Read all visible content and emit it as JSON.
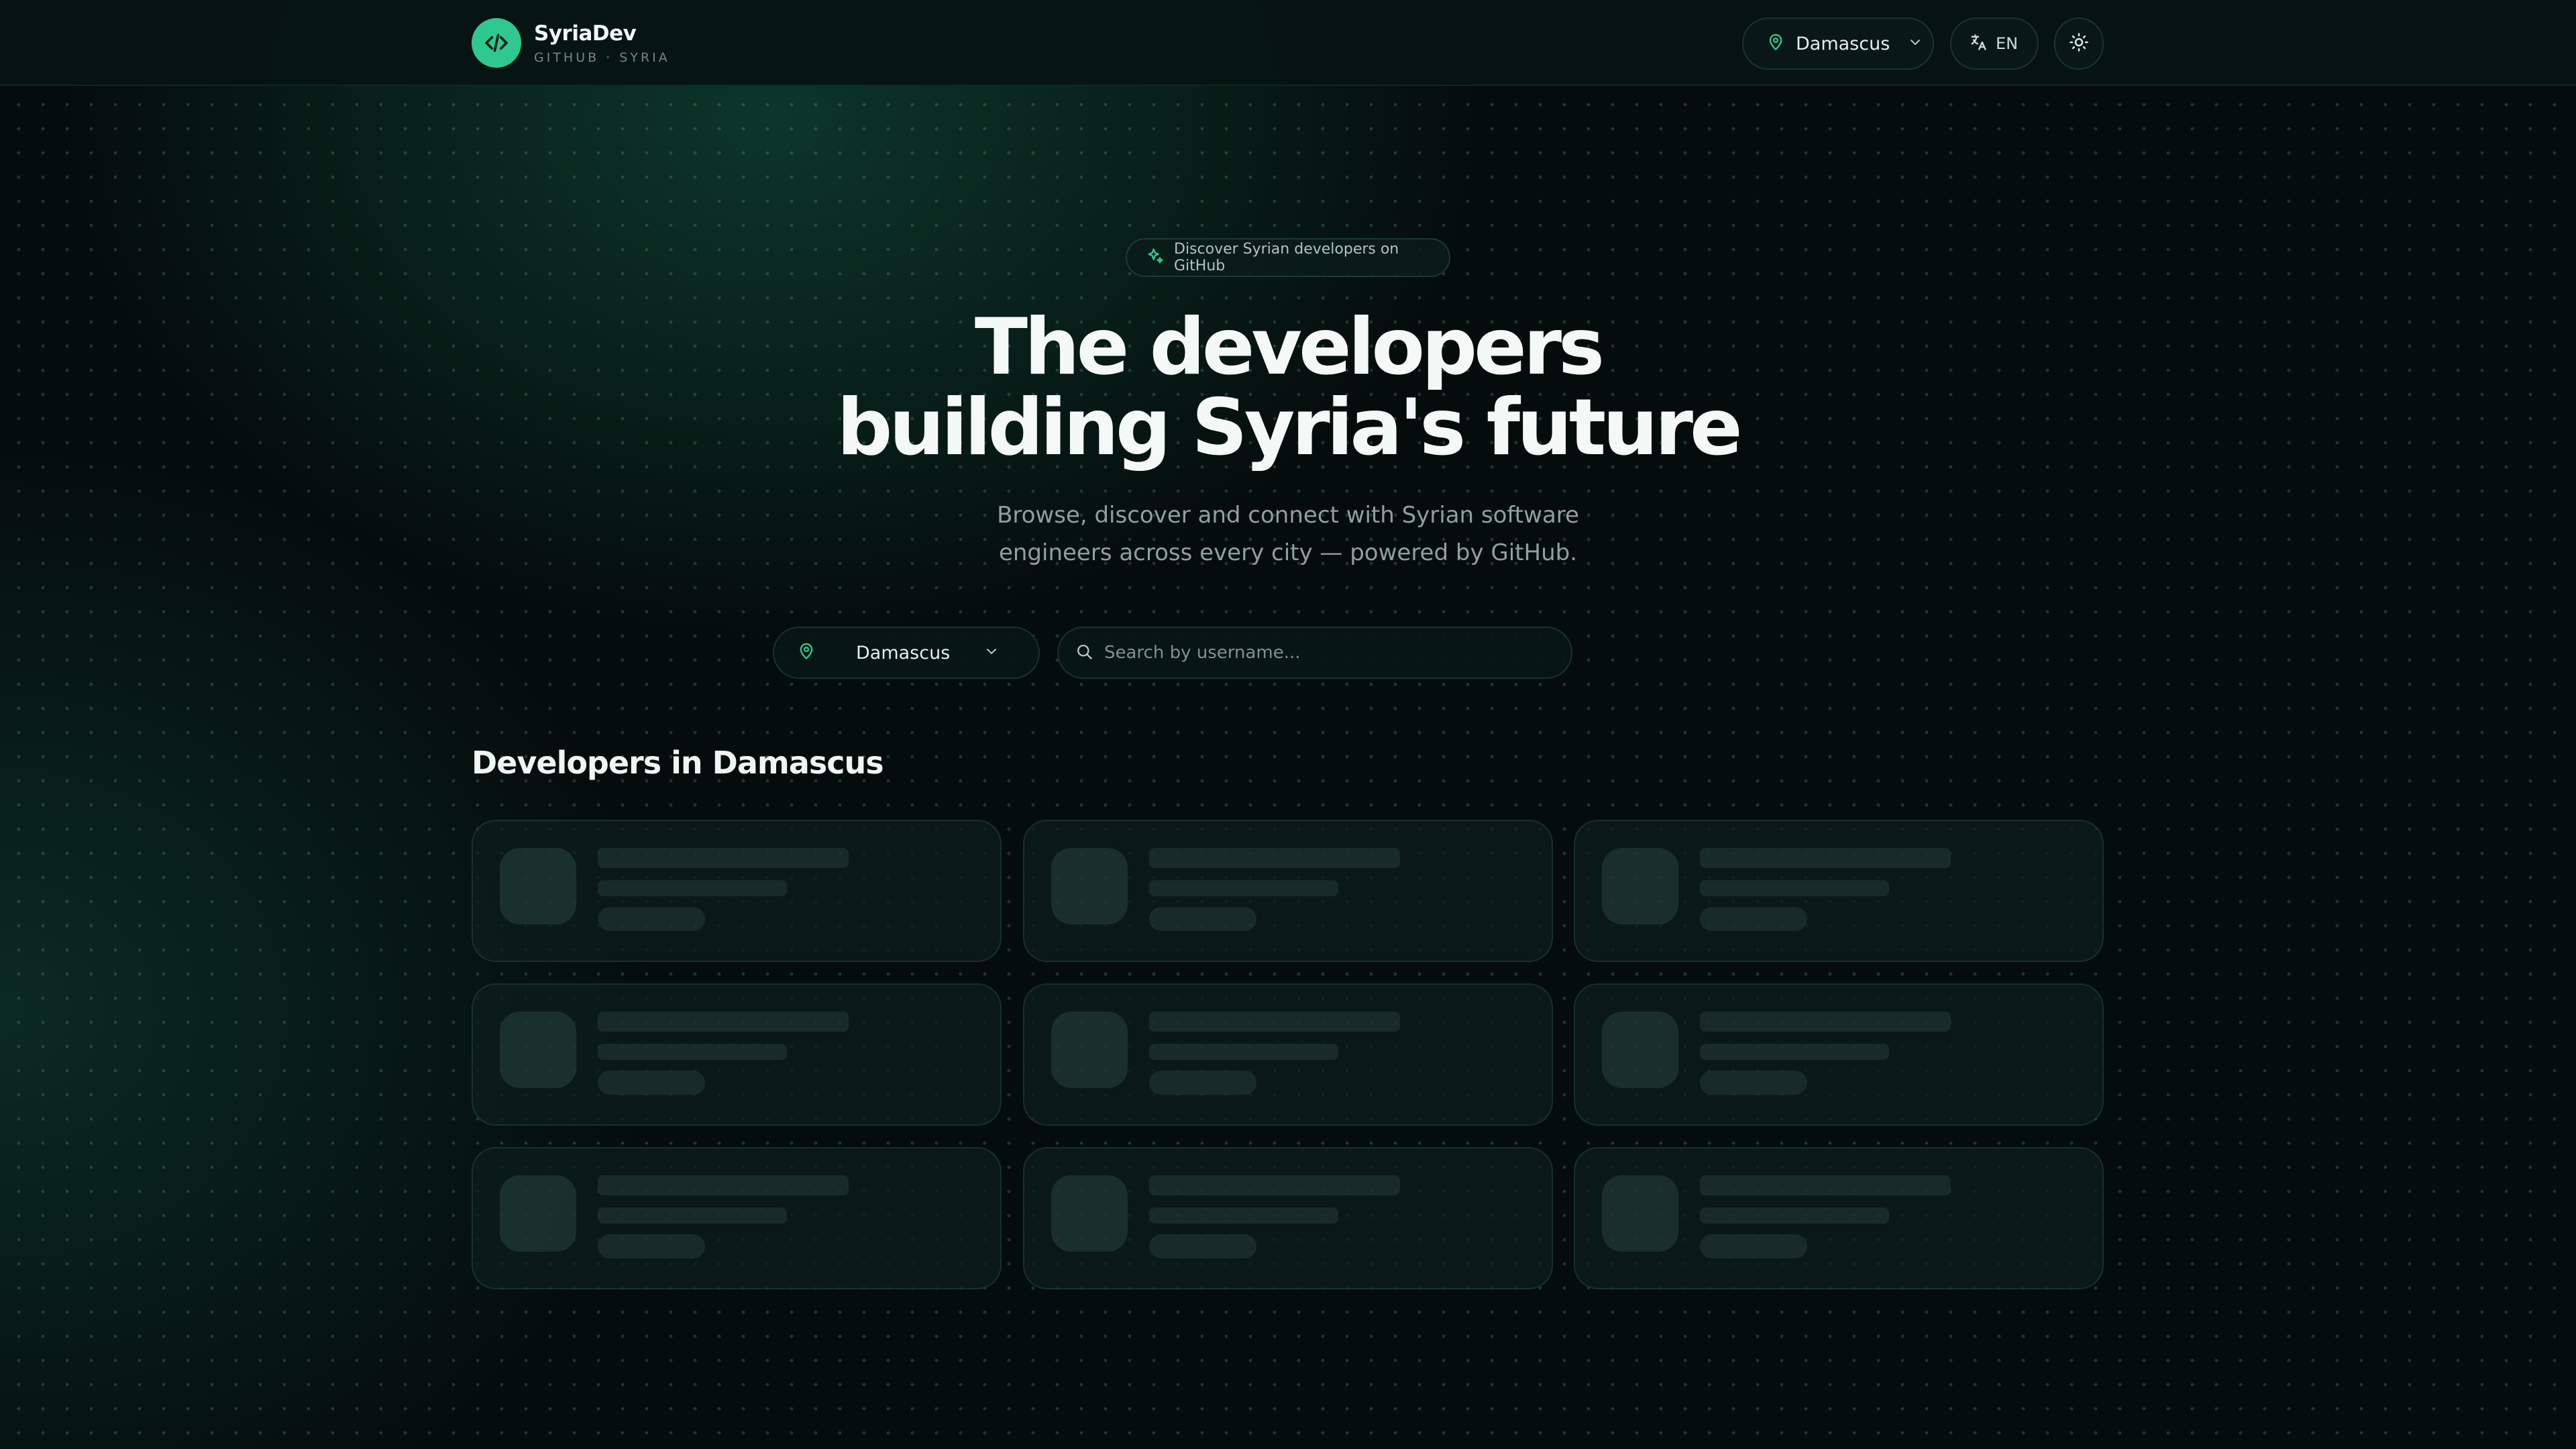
{
  "brand": {
    "name": "SyriaDev",
    "subtitle": "GITHUB · SYRIA"
  },
  "header": {
    "city": "Damascus",
    "language": "EN"
  },
  "hero": {
    "tag": "Discover Syrian developers on GitHub",
    "title_line1": "The developers",
    "title_line2": "building Syria's future",
    "subtitle_line1": "Browse, discover and connect with Syrian software",
    "subtitle_line2": "engineers across every city — powered by GitHub."
  },
  "filters": {
    "city": "Damascus",
    "search_placeholder": "Search by username..."
  },
  "section": {
    "title": "Developers in Damascus"
  },
  "colors": {
    "accent": "#2fc98f",
    "background": "#050d0c"
  },
  "icons": {
    "logo": "code-brackets-icon",
    "location": "map-pin-icon",
    "chevron": "chevron-down-icon",
    "language": "translate-icon",
    "theme": "sun-icon",
    "tag": "sparkles-icon",
    "search": "search-icon"
  }
}
